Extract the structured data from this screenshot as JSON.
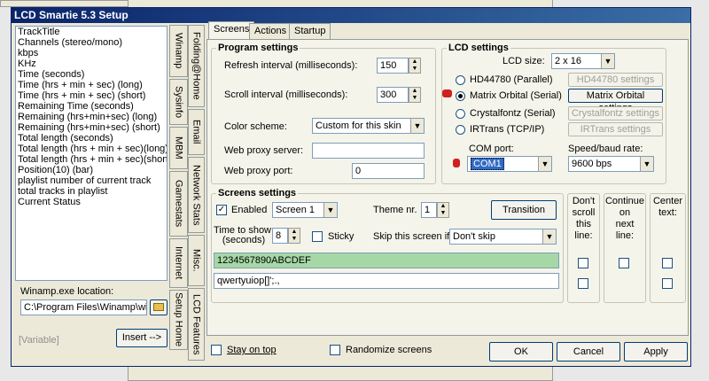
{
  "window": {
    "title": "LCD Smartie 5.3 Setup"
  },
  "left": {
    "items": [
      "TrackTitle",
      "Channels (stereo/mono)",
      "kbps",
      "KHz",
      "Time (seconds)",
      "Time (hrs + min + sec) (long)",
      "Time (hrs + min + sec) (short)",
      "Remaining Time (seconds)",
      "Remaining (hrs+min+sec) (long)",
      "Remaining (hrs+min+sec) (short)",
      "Total length (seconds)",
      "Total length (hrs + min + sec)(long)",
      "Total length (hrs + min + sec)(short)",
      "Position(10) (bar)",
      "playlist number of current track",
      "total tracks in playlist",
      "Current Status"
    ],
    "exe_label": "Winamp.exe location:",
    "exe_value": "C:\\Program Files\\Winamp\\wina",
    "variable_label": "[Variable]",
    "insert_button": "Insert -->"
  },
  "vtabs": [
    "Winamp",
    "Sysinfo",
    "MBM",
    "Gamestats",
    "Internet",
    "Setup Home",
    "Folding@Home",
    "Email",
    "Network Stats",
    "Misc.",
    "LCD Features"
  ],
  "tabs": [
    "Screens",
    "Actions",
    "Startup"
  ],
  "program": {
    "title": "Program settings",
    "refresh_label": "Refresh interval (milliseconds):",
    "refresh_value": "150",
    "scroll_label": "Scroll interval (milliseconds):",
    "scroll_value": "300",
    "scheme_label": "Color scheme:",
    "scheme_value": "Custom for this skin",
    "proxy_server_label": "Web proxy server:",
    "proxy_server_value": "",
    "proxy_port_label": "Web proxy port:",
    "proxy_port_value": "0"
  },
  "lcd": {
    "title": "LCD settings",
    "size_label": "LCD size:",
    "size_value": "2 x 16",
    "radios": [
      "HD44780 (Parallel)",
      "Matrix Orbital (Serial)",
      "Crystalfontz (Serial)",
      "IRTrans (TCP/IP)"
    ],
    "selected": 1,
    "buttons": [
      "HD44780 settings",
      "Matrix Orbital settings",
      "Crystalfontz settings",
      "IRTrans settings"
    ],
    "com_label": "COM port:",
    "com_value": "COM1",
    "baud_label": "Speed/baud rate:",
    "baud_value": "9600 bps"
  },
  "screens": {
    "title": "Screens settings",
    "enabled_label": "Enabled",
    "screen_value": "Screen 1",
    "theme_label": "Theme nr.",
    "theme_value": "1",
    "transition_button": "Transition",
    "time_label_1": "Time to show:",
    "time_label_2": "(seconds)",
    "time_value": "8",
    "sticky_label": "Sticky",
    "skip_label": "Skip this screen if:",
    "skip_value": "Don't skip",
    "line1": "1234567890ABCDEF",
    "line2": "qwertyuiop[]';.,",
    "col_headers": [
      [
        "Don't",
        "scroll",
        "this",
        "line:"
      ],
      [
        "Continue",
        "on",
        "next",
        "line:"
      ],
      [
        "Center",
        "text:"
      ]
    ]
  },
  "bottom": {
    "stay_on_top": "Stay on top",
    "randomize": "Randomize screens",
    "ok": "OK",
    "cancel": "Cancel",
    "apply": "Apply"
  }
}
